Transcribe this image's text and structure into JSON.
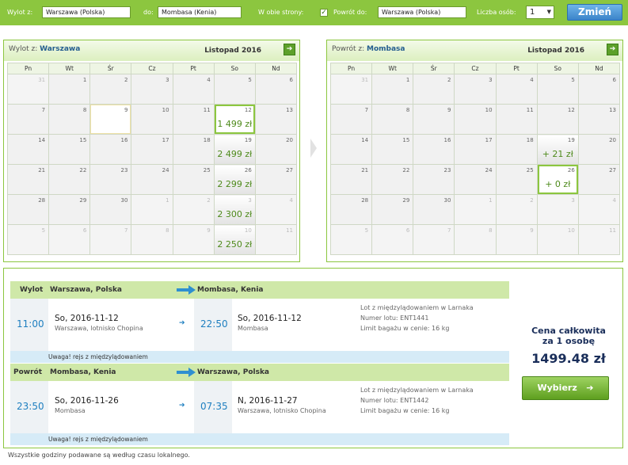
{
  "search": {
    "from_label": "Wylot z:",
    "from_value": "Warszawa (Polska)",
    "to_label": "do:",
    "to_value": "Mombasa (Kenia)",
    "roundtrip_label": "W obie strony:",
    "roundtrip_checked_mark": "✓",
    "return_label": "Powrót do:",
    "return_value": "Warszawa (Polska)",
    "pax_label": "Liczba osób:",
    "pax_value": "1",
    "change_button": "Zmień"
  },
  "outbound_calendar": {
    "title_prefix": "Wylot z:",
    "title_city": "Warszawa",
    "month": "Listopad 2016",
    "weekdays": [
      "Pn",
      "Wt",
      "Śr",
      "Cz",
      "Pt",
      "So",
      "Nd"
    ],
    "weeks": [
      [
        {
          "d": "31",
          "o": true
        },
        {
          "d": "1"
        },
        {
          "d": "2"
        },
        {
          "d": "3"
        },
        {
          "d": "4"
        },
        {
          "d": "5"
        },
        {
          "d": "6"
        }
      ],
      [
        {
          "d": "7"
        },
        {
          "d": "8"
        },
        {
          "d": "9",
          "hl": true
        },
        {
          "d": "10"
        },
        {
          "d": "11"
        },
        {
          "d": "12",
          "p": "1 499 zł",
          "sel": true
        },
        {
          "d": "13"
        }
      ],
      [
        {
          "d": "14"
        },
        {
          "d": "15"
        },
        {
          "d": "16"
        },
        {
          "d": "17"
        },
        {
          "d": "18"
        },
        {
          "d": "19",
          "p": "2 499 zł"
        },
        {
          "d": "20"
        }
      ],
      [
        {
          "d": "21"
        },
        {
          "d": "22"
        },
        {
          "d": "23"
        },
        {
          "d": "24"
        },
        {
          "d": "25"
        },
        {
          "d": "26",
          "p": "2 299 zł"
        },
        {
          "d": "27"
        }
      ],
      [
        {
          "d": "28"
        },
        {
          "d": "29"
        },
        {
          "d": "30"
        },
        {
          "d": "1",
          "o": true
        },
        {
          "d": "2",
          "o": true
        },
        {
          "d": "3",
          "o": true,
          "p": "2 300 zł"
        },
        {
          "d": "4",
          "o": true
        }
      ],
      [
        {
          "d": "5",
          "o": true
        },
        {
          "d": "6",
          "o": true
        },
        {
          "d": "7",
          "o": true
        },
        {
          "d": "8",
          "o": true
        },
        {
          "d": "9",
          "o": true
        },
        {
          "d": "10",
          "o": true,
          "p": "2 250 zł"
        },
        {
          "d": "11",
          "o": true
        }
      ]
    ]
  },
  "return_calendar": {
    "title_prefix": "Powrót z:",
    "title_city": "Mombasa",
    "month": "Listopad 2016",
    "weekdays": [
      "Pn",
      "Wt",
      "Śr",
      "Cz",
      "Pt",
      "So",
      "Nd"
    ],
    "weeks": [
      [
        {
          "d": "31",
          "o": true
        },
        {
          "d": "1"
        },
        {
          "d": "2"
        },
        {
          "d": "3"
        },
        {
          "d": "4"
        },
        {
          "d": "5"
        },
        {
          "d": "6"
        }
      ],
      [
        {
          "d": "7"
        },
        {
          "d": "8"
        },
        {
          "d": "9"
        },
        {
          "d": "10"
        },
        {
          "d": "11"
        },
        {
          "d": "12"
        },
        {
          "d": "13"
        }
      ],
      [
        {
          "d": "14"
        },
        {
          "d": "15"
        },
        {
          "d": "16"
        },
        {
          "d": "17"
        },
        {
          "d": "18"
        },
        {
          "d": "19",
          "p": "+ 21 zł"
        },
        {
          "d": "20"
        }
      ],
      [
        {
          "d": "21"
        },
        {
          "d": "22"
        },
        {
          "d": "23"
        },
        {
          "d": "24"
        },
        {
          "d": "25"
        },
        {
          "d": "26",
          "p": "+ 0 zł",
          "sel": true
        },
        {
          "d": "27"
        }
      ],
      [
        {
          "d": "28"
        },
        {
          "d": "29"
        },
        {
          "d": "30"
        },
        {
          "d": "1",
          "o": true
        },
        {
          "d": "2",
          "o": true
        },
        {
          "d": "3",
          "o": true
        },
        {
          "d": "4",
          "o": true
        }
      ],
      [
        {
          "d": "5",
          "o": true
        },
        {
          "d": "6",
          "o": true
        },
        {
          "d": "7",
          "o": true
        },
        {
          "d": "8",
          "o": true
        },
        {
          "d": "9",
          "o": true
        },
        {
          "d": "10",
          "o": true
        },
        {
          "d": "11",
          "o": true
        }
      ]
    ]
  },
  "outbound": {
    "label": "Wylot",
    "from": "Warszawa, Polska",
    "to": "Mombasa, Kenia",
    "dep_time": "11:00",
    "dep_date": "So, 2016-11-12",
    "dep_airport": "Warszawa, lotnisko Chopina",
    "arr_time": "22:50",
    "arr_date": "So, 2016-11-12",
    "arr_airport": "Mombasa",
    "info_stop": "Lot z międzylądowaniem w Larnaka",
    "info_flight": "Numer lotu:  ENT1441",
    "info_bag": "Limit bagażu w cenie: 16 kg",
    "warning": "Uwaga!  rejs z międzylądowaniem"
  },
  "inbound": {
    "label": "Powrót",
    "from": "Mombasa, Kenia",
    "to": "Warszawa, Polska",
    "dep_time": "23:50",
    "dep_date": "So, 2016-11-26",
    "dep_airport": "Mombasa",
    "arr_time": "07:35",
    "arr_date": "N, 2016-11-27",
    "arr_airport": "Warszawa, lotnisko Chopina",
    "info_stop": "Lot z międzylądowaniem w Larnaka",
    "info_flight": "Numer lotu:  ENT1442",
    "info_bag": "Limit bagażu w cenie: 16 kg",
    "warning": "Uwaga!  rejs z międzylądowaniem"
  },
  "summary": {
    "label_line1": "Cena całkowita",
    "label_line2": "za 1 osobę",
    "price": "1499.48 zł",
    "select_button": "Wybierz"
  },
  "footer": "Wszystkie godziny podawane są według czasu lokalnego.",
  "colors": {
    "brand_green": "#8cc63f",
    "time_blue": "#1e7fc0",
    "price_green": "#4e8a1b",
    "navy": "#1a2e5a"
  }
}
